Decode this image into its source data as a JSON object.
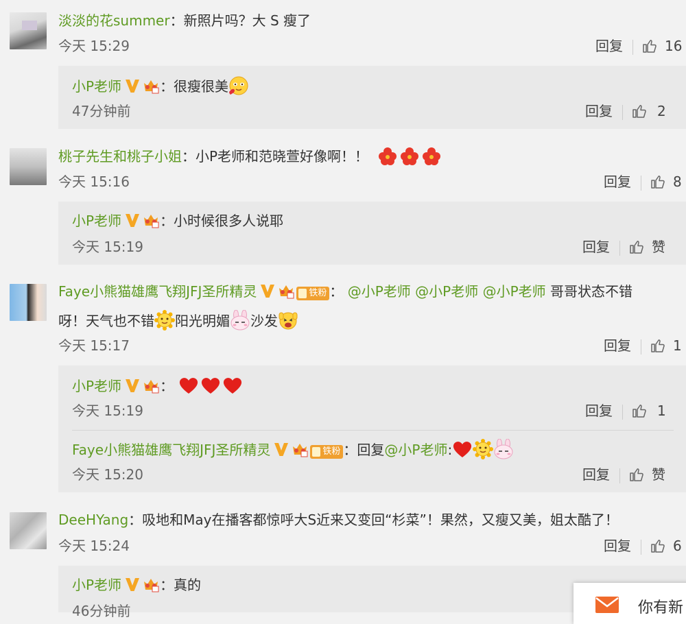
{
  "comments": [
    {
      "user": "淡淡的花summer",
      "text": "：新照片吗？大 S 瘦了",
      "time": "今天 15:29",
      "reply_label": "回复",
      "likes": "16",
      "replies": [
        {
          "user": "小P老师",
          "text": "：很瘦很美",
          "time": "47分钟前",
          "reply_label": "回复",
          "likes": "2"
        }
      ]
    },
    {
      "user": "桃子先生和桃子小姐",
      "text": "：小P老师和范晓萱好像啊！！",
      "time": "今天 15:16",
      "reply_label": "回复",
      "likes": "8",
      "replies": [
        {
          "user": "小P老师",
          "text": "：小时候很多人说耶",
          "time": "今天 15:19",
          "reply_label": "回复",
          "likes": "赞"
        }
      ]
    },
    {
      "user": "Faye小熊猫雄鹰飞翔JFJ圣所精灵",
      "fan_badge": "铁粉",
      "sep": "：",
      "mentions": [
        "@小P老师",
        "@小P老师",
        "@小P老师"
      ],
      "text_a": " 哥哥状态不错",
      "text_b": "呀！天气也不错",
      "text_c": "阳光明媚",
      "text_d": "沙发",
      "time": "今天 15:17",
      "reply_label": "回复",
      "likes": "1",
      "replies": [
        {
          "user": "小P老师",
          "text": "：",
          "time": "今天 15:19",
          "reply_label": "回复",
          "likes": "1"
        },
        {
          "user": "Faye小熊猫雄鹰飞翔JFJ圣所精灵",
          "fan_badge": "铁粉",
          "text": "：回复",
          "mention": "@小P老师",
          "mention_sep": ":",
          "time": "今天 15:20",
          "reply_label": "回复",
          "likes": "赞"
        }
      ]
    },
    {
      "user": "DeeHYang",
      "text": "：吸地和May在播客都惊呼大S近来又变回“杉菜”！果然，又瘦又美，姐太酷了！",
      "time": "今天 15:24",
      "reply_label": "回复",
      "likes": "6",
      "replies": [
        {
          "user": "小P老师",
          "text": "：真的",
          "time": "46分钟前"
        }
      ]
    }
  ],
  "popup": {
    "text": "你有新"
  },
  "colors": {
    "username": "#5f9b23",
    "verified": "#f5a623",
    "background": "#f2f2f2",
    "reply_bg": "#e9e9e9"
  }
}
